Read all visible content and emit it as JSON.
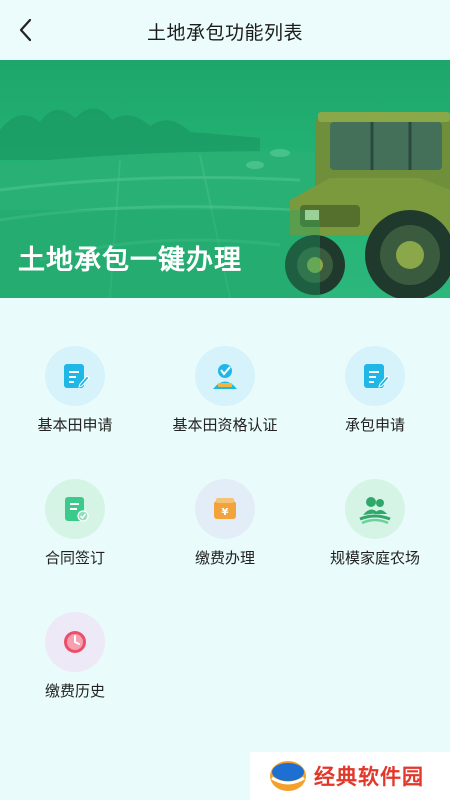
{
  "header": {
    "title": "土地承包功能列表",
    "back_icon": "chevron-left-icon"
  },
  "banner": {
    "headline": "土地承包一键办理",
    "image_subject": "tractor-in-field"
  },
  "functions": [
    {
      "label": "基本田申请",
      "icon": "edit-document-icon",
      "color": "#1fb8e6"
    },
    {
      "label": "基本田资格认证",
      "icon": "verified-user-icon",
      "color": "#1fb8e6"
    },
    {
      "label": "承包申请",
      "icon": "edit-document-icon",
      "color": "#1fb8e6"
    },
    {
      "label": "合同签订",
      "icon": "contract-document-icon",
      "color": "#3cc98c"
    },
    {
      "label": "缴费办理",
      "icon": "yuan-wallet-icon",
      "color": "#f2a33a"
    },
    {
      "label": "规模家庭农场",
      "icon": "family-farm-icon",
      "color": "#2fa86a"
    },
    {
      "label": "缴费历史",
      "icon": "clock-history-icon",
      "color": "#ec4f6a"
    }
  ],
  "watermark": {
    "text": "经典软件园"
  },
  "colors": {
    "page_bg": "#e9fbfb",
    "banner_green": "#23b374",
    "watermark_red": "#e3372a"
  }
}
